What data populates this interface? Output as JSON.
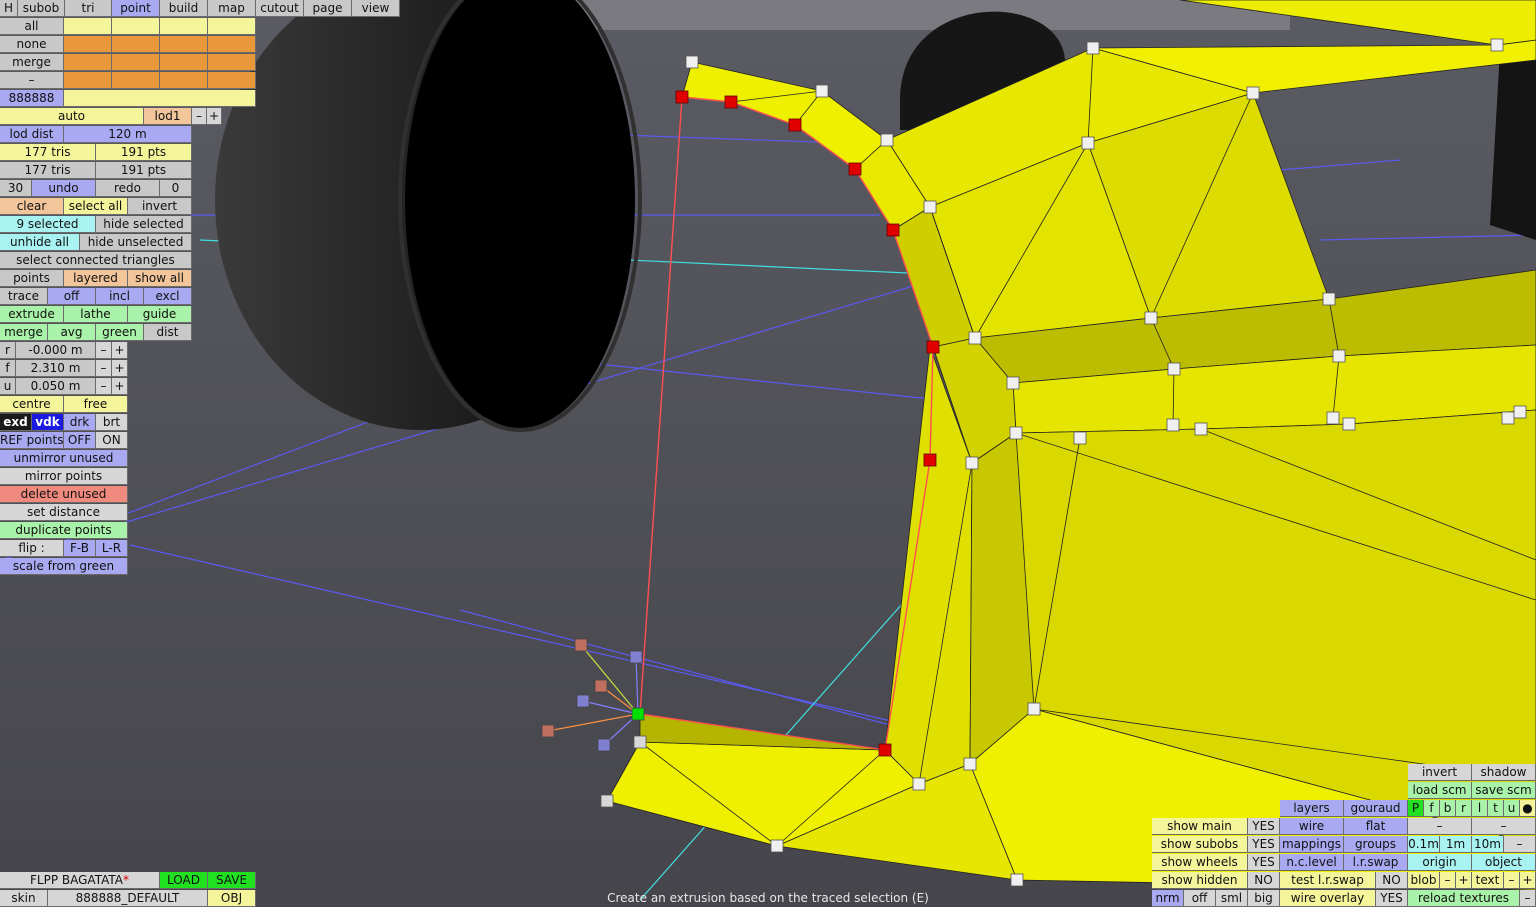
{
  "menu": [
    "H",
    "subob",
    "tri",
    "point",
    "build",
    "map",
    "cutout",
    "page",
    "view"
  ],
  "menu_active": "point",
  "select_rows": [
    "all",
    "none",
    "merge",
    "–"
  ],
  "color_hex": "888888",
  "lod": {
    "mode": "auto",
    "name": "lod1",
    "minus": "–",
    "plus": "+",
    "dist_label": "lod dist",
    "dist_value": "120 m"
  },
  "counts": {
    "tris_a": "177 tris",
    "pts_a": "191 pts",
    "tris_b": "177 tris",
    "pts_b": "191 pts"
  },
  "undo": {
    "count_left": "30",
    "undo": "undo",
    "redo": "redo",
    "count_right": "0"
  },
  "selection": {
    "clear": "clear",
    "select_all": "select all",
    "invert": "invert",
    "selected": "9 selected",
    "hide_selected": "hide selected",
    "unhide_all": "unhide all",
    "hide_unselected": "hide unselected",
    "select_connected": "select connected triangles"
  },
  "points_row": {
    "points": "points",
    "layered": "layered",
    "show_all": "show all"
  },
  "trace_row": {
    "trace": "trace",
    "off": "off",
    "incl": "incl",
    "excl": "excl"
  },
  "extrude_row": {
    "extrude": "extrude",
    "lathe": "lathe",
    "guide": "guide"
  },
  "merge_row": {
    "merge": "merge",
    "avg": "avg",
    "green": "green",
    "dist": "dist"
  },
  "coords": [
    {
      "axis": "r",
      "value": "-0.000 m"
    },
    {
      "axis": "f",
      "value": "2.310 m"
    },
    {
      "axis": "u",
      "value": "0.050 m"
    }
  ],
  "centre_row": {
    "centre": "centre",
    "free": "free"
  },
  "shade_row": [
    "exd",
    "vdk",
    "drk",
    "brt"
  ],
  "ref_row": {
    "label": "REF points",
    "off": "OFF",
    "on": "ON"
  },
  "actions": [
    "unmirror unused",
    "mirror points",
    "delete unused",
    "set distance",
    "duplicate points"
  ],
  "flip_row": {
    "label": "flip :",
    "fb": "F-B",
    "lr": "L-R"
  },
  "scale_from_green": "scale from green",
  "project": {
    "name": "FLPP BAGATATA",
    "modified_mark": "*",
    "load": "LOAD",
    "save": "SAVE"
  },
  "skin": {
    "label": "skin",
    "value": "888888_DEFAULT",
    "format": "OBJ"
  },
  "status_text": "Create an extrusion based on the traced selection (E)",
  "view_panel": {
    "invert": "invert",
    "shadow": "shadow",
    "load_scm": "load scm",
    "save_scm": "save scm",
    "layers": "layers",
    "gouraud": "gouraud",
    "flags": [
      "P",
      "f",
      "b",
      "r",
      "l",
      "t",
      "u",
      "●"
    ],
    "wire": "wire",
    "flat": "flat",
    "dash1": "–",
    "dash2": "–",
    "mappings": "mappings",
    "groups": "groups",
    "g01": "0.1m",
    "g1": "1m",
    "g10": "10m",
    "gminus": "–",
    "nclevel": "n.c.level",
    "lrswap": "l.r.swap",
    "origin": "origin",
    "object": "object",
    "test_lrswap": "test l.r.swap",
    "test_lrswap_val": "NO",
    "blob": "blob",
    "blob_minus": "–",
    "blob_plus": "+",
    "text": "text",
    "text_minus": "–",
    "text_plus": "+",
    "wire_overlay": "wire overlay",
    "wire_overlay_val": "YES",
    "reload_textures": "reload textures",
    "reload_minus": "–"
  },
  "show_panel": [
    {
      "label": "show main",
      "value": "YES"
    },
    {
      "label": "show subobs",
      "value": "YES"
    },
    {
      "label": "show wheels",
      "value": "YES"
    },
    {
      "label": "show hidden",
      "value": "NO"
    }
  ],
  "normals_row": [
    "nrm",
    "off",
    "sml",
    "big"
  ],
  "colors": {
    "mesh": "#eaea00",
    "selected_point": "#e00000",
    "green_point": "#00e000",
    "wire_blue": "#6060ff",
    "wire_cyan": "#40e0e0"
  }
}
